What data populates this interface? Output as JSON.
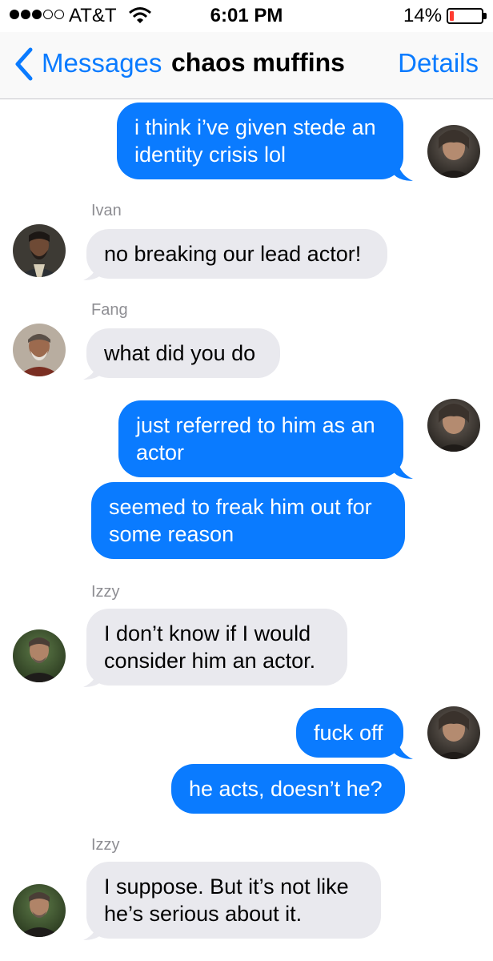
{
  "status_bar": {
    "carrier": "AT&T",
    "time": "6:01 PM",
    "battery_percent": "14%",
    "battery_level": 0.14,
    "signal_strength": 3,
    "signal_max": 5
  },
  "nav": {
    "back_label": "Messages",
    "title": "chaos muffins",
    "details_label": "Details"
  },
  "colors": {
    "outgoing": "#0a7bff",
    "incoming": "#e9e9ee",
    "battery_low": "#ff3b30"
  },
  "messages": [
    {
      "sender": "me",
      "text": "i think i’ve given stede an\nidentity crisis lol"
    },
    {
      "sender": "Ivan",
      "text": "no breaking our lead actor!"
    },
    {
      "sender": "Fang",
      "text": "what did you do"
    },
    {
      "sender": "me",
      "text": "just referred to him as an\nactor"
    },
    {
      "sender": "me",
      "text": "seemed to freak him out for\nsome reason"
    },
    {
      "sender": "Izzy",
      "text": "I don’t know if I would\nconsider him an actor."
    },
    {
      "sender": "me",
      "text": "fuck off"
    },
    {
      "sender": "me",
      "text": "he acts, doesn’t he?"
    },
    {
      "sender": "Izzy",
      "text": "I suppose. But it’s not like\nhe’s serious about it."
    }
  ]
}
